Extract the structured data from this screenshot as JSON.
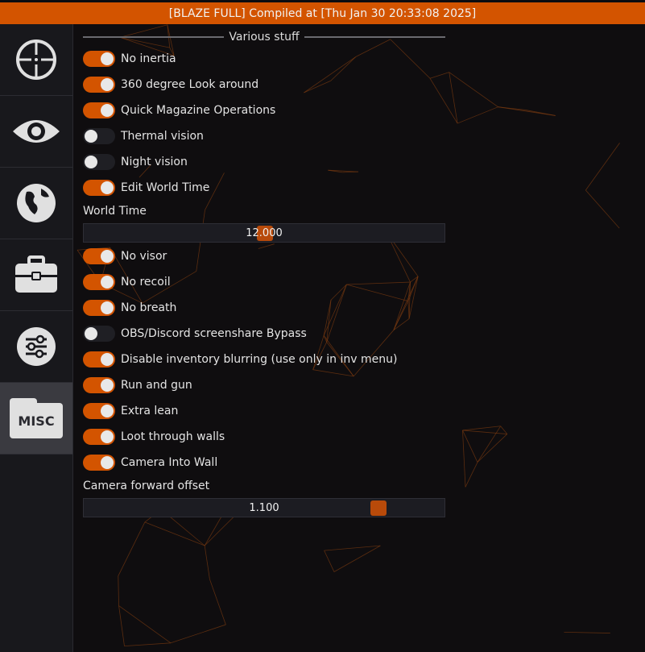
{
  "title_bar": {
    "text": "[BLAZE FULL] Compiled at [Thu Jan 30 20:33:08 2025]"
  },
  "colors": {
    "accent": "#d35400",
    "toggle_off": "#1f1f24",
    "sidebar": "#18181c",
    "sidebar_active": "#3a3a40"
  },
  "sidebar": {
    "items": [
      {
        "icon": "crosshair-icon",
        "active": false
      },
      {
        "icon": "eye-icon",
        "active": false
      },
      {
        "icon": "globe-icon",
        "active": false
      },
      {
        "icon": "briefcase-icon",
        "active": false
      },
      {
        "icon": "sliders-icon",
        "active": false
      },
      {
        "icon": "misc-folder-icon",
        "label": "MISC",
        "active": true
      }
    ]
  },
  "section": {
    "title": "Various stuff"
  },
  "toggles": [
    {
      "label": "No inertia",
      "on": true
    },
    {
      "label": "360 degree Look around",
      "on": true
    },
    {
      "label": "Quick Magazine Operations",
      "on": true
    },
    {
      "label": "Thermal vision",
      "on": false
    },
    {
      "label": "Night vision",
      "on": false
    },
    {
      "label": "Edit World Time",
      "on": true
    },
    {
      "label": "No visor",
      "on": true
    },
    {
      "label": "No recoil",
      "on": true
    },
    {
      "label": "No breath",
      "on": true
    },
    {
      "label": "OBS/Discord screenshare Bypass",
      "on": false
    },
    {
      "label": "Disable inventory blurring (use only in inv menu)",
      "on": true
    },
    {
      "label": "Run and gun",
      "on": true
    },
    {
      "label": "Extra lean",
      "on": true
    },
    {
      "label": "Loot through walls",
      "on": true
    },
    {
      "label": "Camera Into Wall",
      "on": true
    }
  ],
  "sliders": {
    "world_time": {
      "label": "World Time",
      "value": "12.000",
      "fraction": 0.5
    },
    "camera_offset": {
      "label": "Camera forward offset",
      "value": "1.100",
      "fraction": 0.83
    }
  }
}
